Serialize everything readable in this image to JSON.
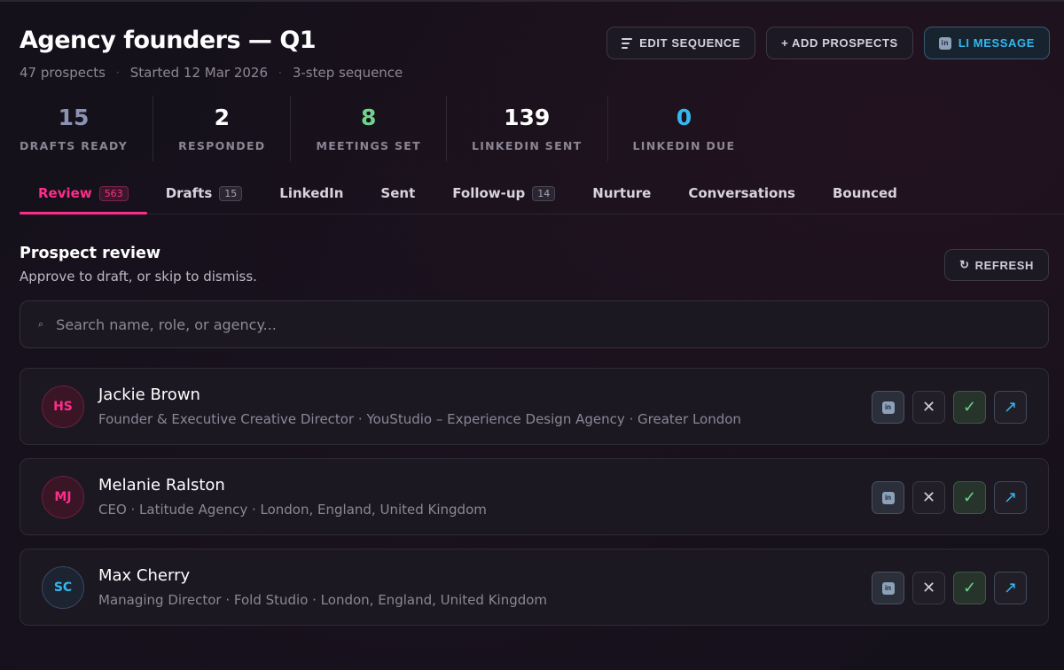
{
  "header": {
    "title": "Agency founders — Q1",
    "meta": [
      "47 prospects",
      "Started 12 Mar 2026",
      "3-step sequence"
    ],
    "meta_separator": "·"
  },
  "actions": {
    "edit_sequence": "EDIT SEQUENCE",
    "add_prospects": "+ ADD PROSPECTS",
    "li_message": "LI MESSAGE",
    "li_badge": "in"
  },
  "stats": [
    {
      "value": "15",
      "label": "DRAFTS READY",
      "color": "#8b93b3"
    },
    {
      "value": "2",
      "label": "RESPONDED",
      "color": "#ffffff"
    },
    {
      "value": "8",
      "label": "MEETINGS SET",
      "color": "#6fd48b"
    },
    {
      "value": "139",
      "label": "LINKEDIN SENT",
      "color": "#ffffff"
    },
    {
      "value": "0",
      "label": "LINKEDIN DUE",
      "color": "#35b7f0"
    }
  ],
  "tabs": [
    {
      "label": "Review",
      "badge": "563",
      "active": true
    },
    {
      "label": "Drafts",
      "badge": "15"
    },
    {
      "label": "LinkedIn",
      "badge": ""
    },
    {
      "label": "Sent",
      "badge": ""
    },
    {
      "label": "Follow-up",
      "badge": "14"
    },
    {
      "label": "Nurture",
      "badge": ""
    },
    {
      "label": "Conversations",
      "badge": ""
    },
    {
      "label": "Bounced",
      "badge": ""
    }
  ],
  "section": {
    "title": "Prospect review",
    "subtitle": "Approve to draft, or skip to dismiss.",
    "refresh_label": "REFRESH",
    "refresh_icon": "↻"
  },
  "search": {
    "placeholder": "Search name, role, or agency...",
    "value": "",
    "icon": "⌕"
  },
  "prospects": [
    {
      "initials": "HS",
      "name": "Jackie Brown",
      "subtitle": "Founder & Executive Creative Director · YouStudio – Experience Design Agency · Greater London",
      "avatar_style": "pink"
    },
    {
      "initials": "MJ",
      "name": "Melanie Ralston",
      "subtitle": "CEO · Latitude Agency · London, England, United Kingdom",
      "avatar_style": "pink"
    },
    {
      "initials": "SC",
      "name": "Max Cherry",
      "subtitle": "Managing Director · Fold Studio · London, England, United Kingdom",
      "avatar_style": "blue"
    }
  ],
  "row_actions": {
    "linkedin": "in",
    "skip": "✕",
    "approve": "✓",
    "open": "↗"
  },
  "colors": {
    "accent": "#ff2d8a",
    "linkedin": "#35b7f0",
    "success": "#6fd48b",
    "background": "#15111b"
  }
}
